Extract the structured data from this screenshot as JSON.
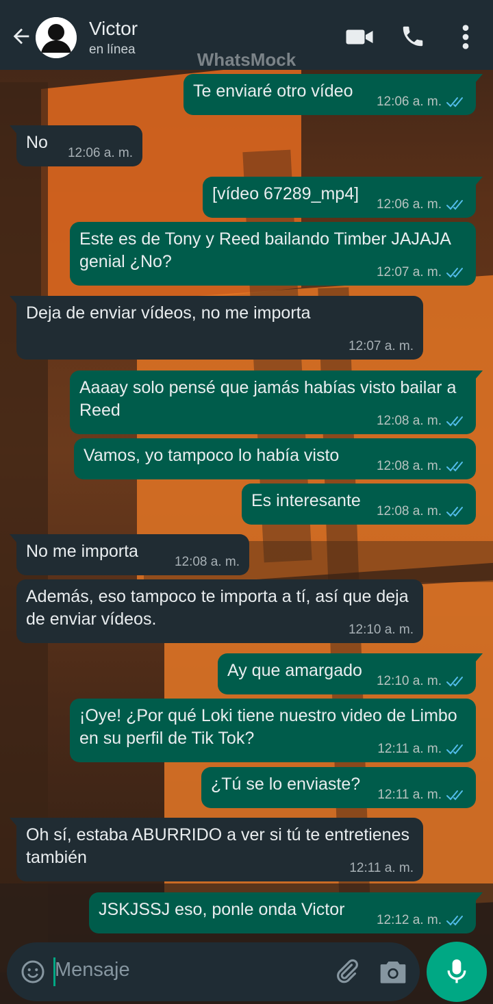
{
  "header": {
    "contact_name": "Victor",
    "status": "en línea",
    "watermark": "WhatsMock"
  },
  "messages": [
    {
      "dir": "out",
      "text": "Te enviaré otro vídeo",
      "time": "12:06 a. m."
    },
    {
      "dir": "in",
      "text": "No",
      "time": "12:06 a. m."
    },
    {
      "dir": "out",
      "text": "[vídeo 67289_mp4]",
      "time": "12:06 a. m."
    },
    {
      "dir": "out",
      "text": "Este es de Tony y Reed bailando Timber JAJAJA genial ¿No?",
      "time": "12:07 a. m."
    },
    {
      "dir": "in",
      "text": "Deja de enviar vídeos, no me importa",
      "time": "12:07 a. m."
    },
    {
      "dir": "out",
      "text": "Aaaay solo pensé que jamás habías visto bailar a Reed",
      "time": "12:08 a. m."
    },
    {
      "dir": "out",
      "text": "Vamos, yo tampoco lo había visto",
      "time": "12:08 a. m."
    },
    {
      "dir": "out",
      "text": "Es interesante",
      "time": "12:08 a. m."
    },
    {
      "dir": "in",
      "text": "No me importa",
      "time": "12:08 a. m."
    },
    {
      "dir": "in",
      "text": "Además, eso tampoco te importa a tí, así que deja de enviar vídeos.",
      "time": "12:10 a. m."
    },
    {
      "dir": "out",
      "text": "Ay que amargado",
      "time": "12:10 a. m."
    },
    {
      "dir": "out",
      "text": "¡Oye! ¿Por qué Loki tiene nuestro video de Limbo en su perfil de Tik Tok?",
      "time": "12:11 a. m."
    },
    {
      "dir": "out",
      "text": "¿Tú se lo enviaste?",
      "time": "12:11 a. m."
    },
    {
      "dir": "in",
      "text": "Oh sí, estaba ABURRIDO a ver si tú te entretienes también",
      "time": "12:11 a. m."
    },
    {
      "dir": "out",
      "text": "JSKJSSJ eso, ponle onda Victor",
      "time": "12:12 a. m."
    }
  ],
  "composer": {
    "placeholder": "Mensaje"
  },
  "icons": {
    "back": "arrow-left-icon",
    "video_call": "video-camera-icon",
    "voice_call": "phone-icon",
    "menu": "more-vertical-icon",
    "emoji": "emoji-icon",
    "attach": "paperclip-icon",
    "camera": "camera-icon",
    "mic": "microphone-icon",
    "read": "double-check-icon"
  },
  "colors": {
    "header_bg": "#1f2c34",
    "outgoing_bubble": "#005c4b",
    "incoming_bubble": "#202c33",
    "accent": "#00a884",
    "read_ticks": "#53bdeb"
  }
}
